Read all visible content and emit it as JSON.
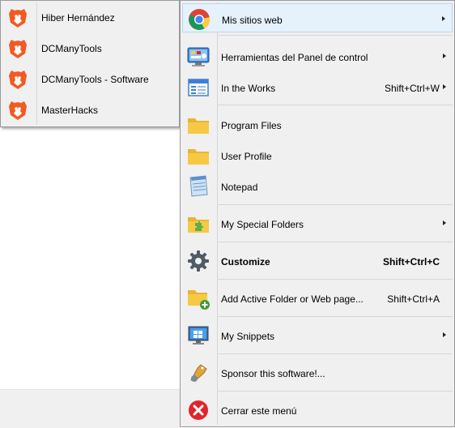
{
  "submenu": {
    "items": [
      {
        "label": "Hiber Hernández",
        "icon": "brave-lion-icon"
      },
      {
        "label": "DCManyTools",
        "icon": "brave-lion-icon"
      },
      {
        "label": "DCManyTools - Software",
        "icon": "brave-lion-icon"
      },
      {
        "label": "MasterHacks",
        "icon": "brave-lion-icon"
      }
    ]
  },
  "menu": {
    "items": [
      {
        "label": "Mis sitios web",
        "icon": "chrome-icon",
        "submenu": true,
        "highlighted": true
      },
      {
        "label": "Herramientas del Panel de control",
        "icon": "control-panel-icon",
        "submenu": true
      },
      {
        "label": "In the Works",
        "icon": "window-list-icon",
        "shortcut": "Shift+Ctrl+W",
        "submenu": true
      },
      {
        "label": "Program Files",
        "icon": "folder-icon"
      },
      {
        "label": "User Profile",
        "icon": "folder-icon"
      },
      {
        "label": "Notepad",
        "icon": "notepad-icon"
      },
      {
        "label": "My Special Folders",
        "icon": "special-folder-icon",
        "submenu": true
      },
      {
        "label": "Customize",
        "icon": "gear-icon",
        "shortcut": "Shift+Ctrl+C",
        "bold": true
      },
      {
        "label": "Add Active Folder or Web page...",
        "icon": "add-folder-icon",
        "shortcut": "Shift+Ctrl+A"
      },
      {
        "label": "My Snippets",
        "icon": "monitor-icon",
        "submenu": true
      },
      {
        "label": "Sponsor this software!...",
        "icon": "sponsor-icon"
      },
      {
        "label": "Cerrar este menú",
        "icon": "close-icon"
      }
    ]
  },
  "colors": {
    "menu_bg": "#f0f0f0",
    "highlight_bg": "#e5f1fb",
    "highlight_border": "#b9d7f0",
    "brave_orange": "#f15a22",
    "folder_yellow": "#f6c945",
    "close_red": "#e0262b"
  }
}
